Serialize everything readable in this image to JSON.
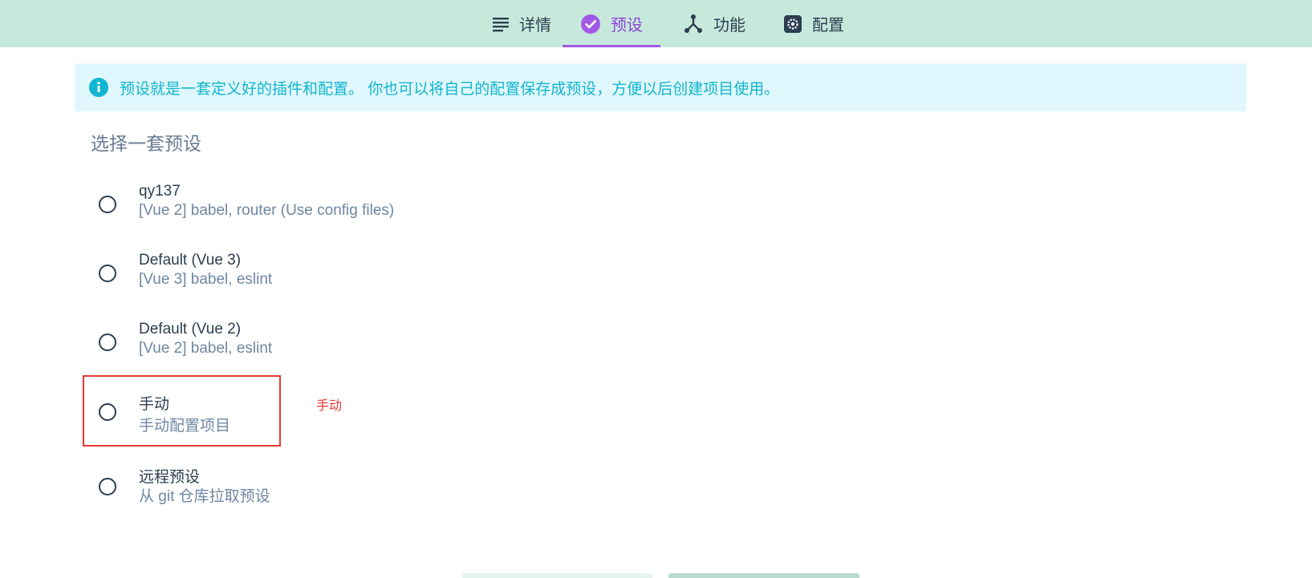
{
  "tabs": [
    {
      "label": "详情",
      "icon": "list-icon",
      "active": false
    },
    {
      "label": "预设",
      "icon": "check-circle-icon",
      "active": true
    },
    {
      "label": "功能",
      "icon": "fork-icon",
      "active": false
    },
    {
      "label": "配置",
      "icon": "gear-icon",
      "active": false
    }
  ],
  "info": {
    "icon": "info-icon",
    "text": "预设就是一套定义好的插件和配置。 你也可以将自己的配置保存成预设，方便以后创建项目使用。"
  },
  "section_title": "选择一套预设",
  "presets": [
    {
      "name": "qy137",
      "description": "[Vue 2] babel, router (Use config files)",
      "selected": false
    },
    {
      "name": "Default (Vue 3)",
      "description": "[Vue 3] babel, eslint",
      "selected": false
    },
    {
      "name": "Default (Vue 2)",
      "description": "[Vue 2] babel, eslint",
      "selected": false
    },
    {
      "name": "手动",
      "description": "手动配置项目",
      "selected": false
    },
    {
      "name": "远程预设",
      "description": "从 git 仓库拉取预设",
      "selected": false
    }
  ],
  "annotation": {
    "label": "手动"
  },
  "colors": {
    "tabbar_bg": "#c6e9dc",
    "accent": "#a259e6",
    "info_text": "#12b5cf",
    "info_bg": "#e0f8fd",
    "highlight": "#e53935"
  }
}
